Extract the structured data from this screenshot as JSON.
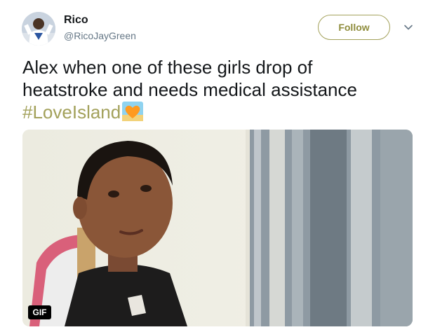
{
  "user": {
    "name": "Rico",
    "handle": "@RicoJayGreen"
  },
  "follow_label": "Follow",
  "tweet": {
    "line1": "Alex when one of these girls drop of",
    "line2": "heatstroke and needs medical assistance",
    "hashtag": "#LoveIsland"
  },
  "media": {
    "badge": "GIF"
  },
  "icons": {
    "caret": "chevron-down-icon",
    "emoji": "heart-emoji-icon"
  },
  "colors": {
    "accent": "#a3a15b",
    "text": "#14171a",
    "muted": "#657786"
  }
}
